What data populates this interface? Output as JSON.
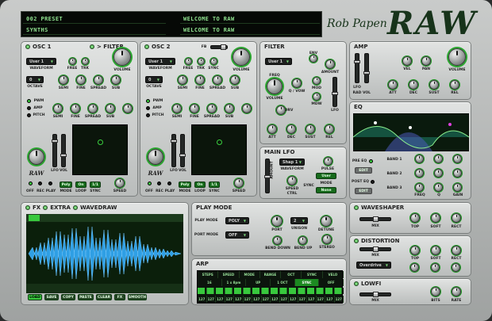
{
  "header": {
    "preset": "002 PRESET",
    "bank": "SYNTHS",
    "msg1": "WELCOME TO RAW",
    "msg2": "WELCOME TO RAW",
    "brand_small": "Rob Papen",
    "brand_big": "RAW"
  },
  "osc1": {
    "title": "OSC 1",
    "filter_label": "> FILTER",
    "waveform": "User 1",
    "waveform_label": "WAVEFORM",
    "free": "FREE",
    "trk": "TRK",
    "octave_val": "0",
    "octave_label": "OCTAVE",
    "volume": "VOLUME",
    "semi": "SEMI",
    "fine": "FINE",
    "spread": "SPREAD",
    "sub": "SUB",
    "pwm": "PWM",
    "amp": "AMP",
    "pitch": "PITCH",
    "lfo": "LFO",
    "rad": "RAD",
    "vol": "VOL",
    "off": "OFF",
    "rec": "REC",
    "play": "PLAY",
    "mode": "MODE",
    "loop": "LOOP",
    "sync": "SYNC",
    "speed": "SPEED",
    "poly": "Poly",
    "on": "On",
    "val": "1/1",
    "logo": "RAW"
  },
  "osc2": {
    "title": "OSC 2",
    "fb": "FB",
    "waveform": "User 1",
    "waveform_label": "WAVEFORM",
    "free": "FREE",
    "trk": "TRK",
    "sync": "SYNC",
    "octave_val": "0",
    "octave_label": "OCTAVE",
    "volume": "VOLUME",
    "semi": "SEMI",
    "fine": "FINE",
    "spread": "SPREAD",
    "sub": "SUB",
    "pwm": "PWM",
    "amp": "AMP",
    "pitch": "PITCH",
    "lfo": "LFO",
    "rad": "RAD",
    "vol": "VOL",
    "off": "OFF",
    "rec": "REC",
    "play": "PLAY",
    "mode": "MODE",
    "loop": "LOOP",
    "speed": "SPEED",
    "poly": "Poly",
    "on": "On",
    "val": "1/1",
    "logo": "RAW"
  },
  "filter": {
    "title": "FILTER",
    "type": "User 1",
    "freq": "FREQ",
    "env": "ENV",
    "amount": "AMOUNT",
    "volume": "VOLUME",
    "q_vow": "Q / VOW",
    "mod": "MOD",
    "mdw": "MDW",
    "lfo": "LFO",
    "drv": "DRV",
    "att": "ATT",
    "dec": "DEC",
    "sust": "SUST",
    "rel": "REL"
  },
  "amp": {
    "title": "AMP",
    "lfo": "LFO",
    "rad": "RAD",
    "vol": "VOL",
    "vel": "VEL",
    "pan": "PAN",
    "volume": "VOLUME",
    "att": "ATT",
    "dec": "DEC",
    "sust": "SUST",
    "rel": "REL"
  },
  "eq": {
    "title": "EQ",
    "pre_eq": "PRE EQ",
    "post_eq": "POST EQ",
    "edit": "EDIT",
    "edit2": "EDIT",
    "band1": "BAND 1",
    "band2": "BAND 2",
    "band3": "BAND 3",
    "freq": "FREQ",
    "q": "Q",
    "gain": "GAIN"
  },
  "mainlfo": {
    "title": "MAIN LFO",
    "shape": "Shap 1",
    "waveform": "WAVEFORM",
    "pulse": "PULSE",
    "user": "User",
    "mode_label": "MODE",
    "mode": "None",
    "speed": "SPEED",
    "ctrl": "CTRL",
    "sync": "SYNC",
    "amount": "AMOUNT"
  },
  "fx": {
    "fx": "FX",
    "extra": "EXTRA",
    "wavedraw": "WAVEDRAW",
    "tabs": [
      "LOAD",
      "SAVE",
      "COPY",
      "PASTE",
      "CLEAR",
      "FX",
      "SMOOTH"
    ]
  },
  "playmode": {
    "title": "PLAY MODE",
    "play_label": "PLAY MODE",
    "play": "POLY",
    "port_label": "PORT MODE",
    "port": "OFF",
    "port_knob": "PORT",
    "unison_val": "2",
    "unison": "UNISON",
    "detune": "DETUNE",
    "bend_down": "BEND DOWN",
    "bend_up": "BEND UP",
    "stereo": "STEREO"
  },
  "arp": {
    "title": "ARP",
    "headers": [
      "STEPS",
      "SPEED",
      "MODE",
      "RANGE",
      "OCT",
      "SYNC",
      "VELO"
    ],
    "values": [
      "16",
      "1 x 8pm",
      "UP",
      "1 OCT",
      "SYNC",
      "OFF"
    ],
    "row": [
      "127",
      "127",
      "127",
      "127",
      "127",
      "127",
      "127",
      "127",
      "127",
      "127",
      "127",
      "127",
      "127",
      "127",
      "127",
      "127"
    ]
  },
  "waveshaper": {
    "title": "WAVESHAPER",
    "mix": "MIX",
    "top": "TOP",
    "soft": "SOFT",
    "rect": "RECT"
  },
  "distortion": {
    "title": "DISTORTION",
    "mix": "MIX",
    "type": "Overdrive",
    "top": "TOP",
    "soft": "SOFT",
    "rect": "RECT"
  },
  "lowfi": {
    "title": "LOWFI",
    "mix": "MIX",
    "bits": "BITS",
    "rate": "RATE"
  }
}
